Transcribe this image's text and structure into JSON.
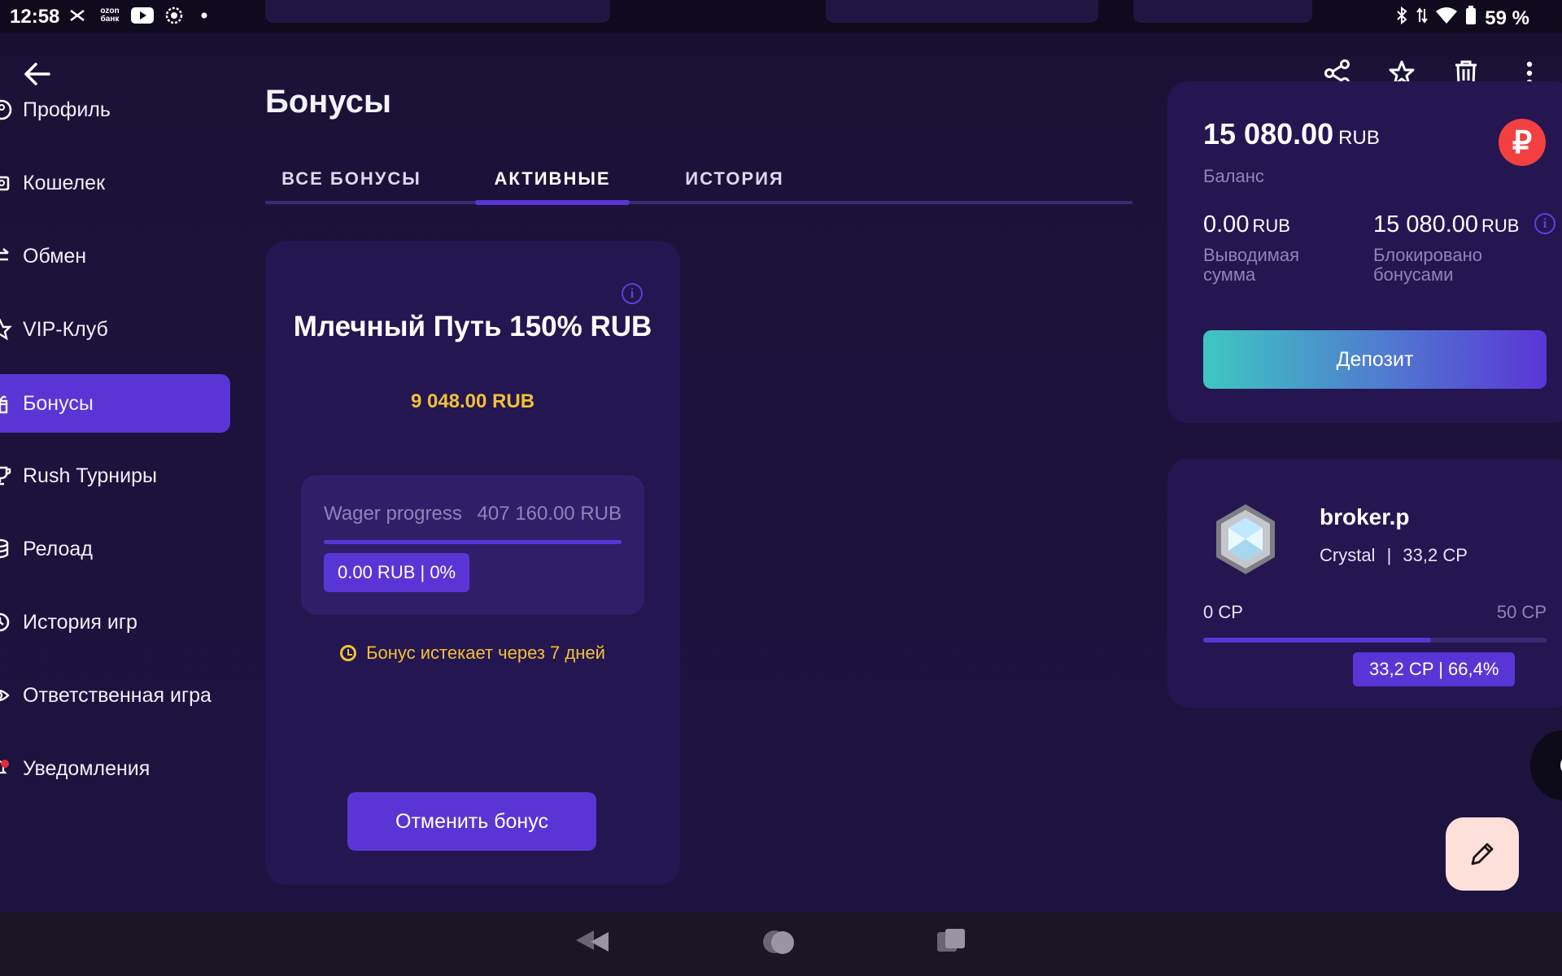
{
  "status_bar": {
    "time": "12:58",
    "battery": "59 %",
    "notif_icons": [
      "vpn-icon",
      "ozon-bank-icon",
      "youtube-icon",
      "settings-notif-icon",
      "dot-icon"
    ],
    "right_icons": [
      "bluetooth-icon",
      "data-icon",
      "wifi-icon",
      "battery-icon"
    ],
    "ozon_label": "ozon банк"
  },
  "toolbar": {
    "icons": [
      "share-icon",
      "star-icon",
      "delete-icon",
      "more-icon"
    ]
  },
  "sidebar": {
    "items": [
      {
        "label": "Профиль",
        "icon": "profile-icon",
        "active": false
      },
      {
        "label": "Кошелек",
        "icon": "wallet-icon",
        "active": false
      },
      {
        "label": "Обмен",
        "icon": "exchange-icon",
        "active": false
      },
      {
        "label": "VIP-Клуб",
        "icon": "star-icon",
        "active": false
      },
      {
        "label": "Бонусы",
        "icon": "gift-icon",
        "active": true
      },
      {
        "label": "Rush Турниры",
        "icon": "trophy-icon",
        "active": false
      },
      {
        "label": "Релоад",
        "icon": "coins-icon",
        "active": false
      },
      {
        "label": "История игр",
        "icon": "history-icon",
        "active": false
      },
      {
        "label": "Ответственная игра",
        "icon": "eye-icon",
        "active": false
      },
      {
        "label": "Уведомления",
        "icon": "bell-icon",
        "active": false
      }
    ]
  },
  "page": {
    "title": "Бонусы",
    "tabs": [
      {
        "label": "ВСЕ БОНУСЫ",
        "active": false
      },
      {
        "label": "АКТИВНЫЕ",
        "active": true
      },
      {
        "label": "ИСТОРИЯ",
        "active": false
      }
    ]
  },
  "bonus": {
    "name": "Млечный Путь 150% RUB",
    "amount": "9 048.00 RUB",
    "wager_label": "Wager progress",
    "wager_total": "407 160.00 RUB",
    "wager_progress_text": "0.00 RUB | 0%",
    "wager_progress": 0,
    "expires": "Бонус истекает через 7 дней",
    "cancel_label": "Отменить бонус"
  },
  "balance": {
    "amount": "15 080.00",
    "currency": "RUB",
    "label": "Баланс",
    "currency_symbol": "₽",
    "withdrawable_amount": "0.00",
    "withdrawable_label": "Выводимая сумма",
    "blocked_amount": "15 080.00",
    "blocked_label": "Блокировано бонусами",
    "deposit_label": "Депозит"
  },
  "vip": {
    "username": "broker.p",
    "level": "Crystal",
    "separator": "|",
    "points": "33,2 CP",
    "min": "0 CP",
    "max": "50 CP",
    "progress_text": "33,2 CP | 66,4%",
    "progress": 0.664
  },
  "colors": {
    "accent": "#5a35d6",
    "background": "#1d1340",
    "card": "#241650",
    "gold": "#f2c036",
    "muted": "#8d84b7",
    "rub_badge": "#f1403f"
  }
}
